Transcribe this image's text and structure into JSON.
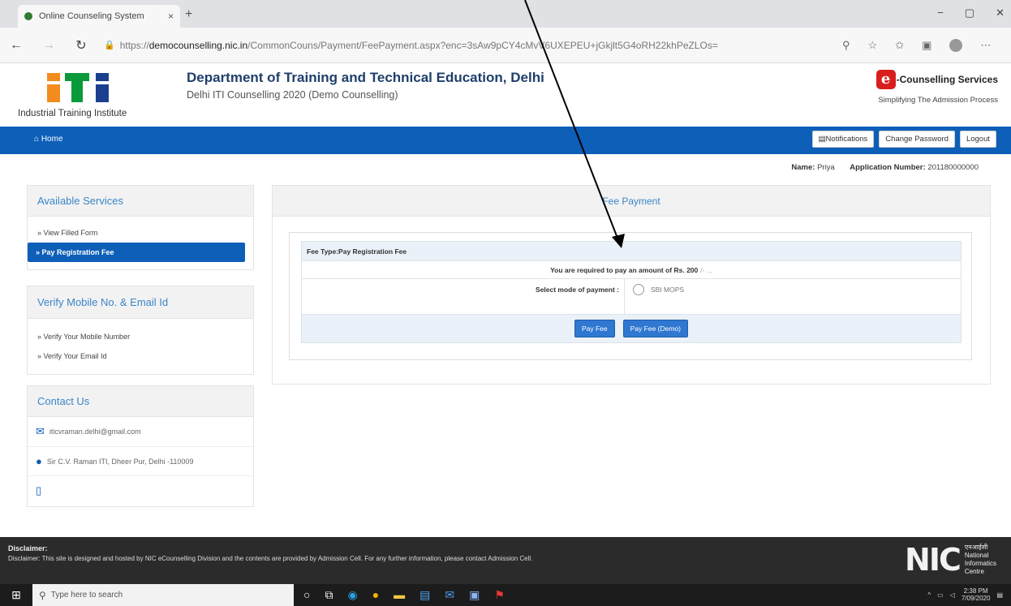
{
  "browser": {
    "tab_title": "Online Counseling System",
    "tab_close": "×",
    "new_tab": "+",
    "url_prefix": "https://",
    "url_host": "democounselling.nic.in",
    "url_path": "/CommonCouns/Payment/FeePayment.aspx?enc=3sAw9pCY4cMvV6UXEPEU+jGkjlt5G4oRH22khPeZLOs=",
    "window_buttons": [
      "−",
      "▢",
      "✕"
    ]
  },
  "header": {
    "iti_caption": "Industrial Training Institute",
    "dept_title": "Department of Training and Technical Education, Delhi",
    "dept_subtitle": "Delhi ITI Counselling 2020 (Demo Counselling)",
    "counselling_title": "-Counselling Services",
    "counselling_tagline": "Simplifying The Admission Process"
  },
  "navbar": {
    "home": "Home",
    "buttons": [
      "Notifications",
      "Change Password",
      "Logout"
    ]
  },
  "user": {
    "name_label": "Name:",
    "name_value": "Priya",
    "app_label": "Application Number:",
    "app_value": "201180000000"
  },
  "sidebar": {
    "services_title": "Available Services",
    "services": [
      "View Filled Form",
      "Pay Registration Fee"
    ],
    "verify_title": "Verify Mobile No. & Email Id",
    "verify_items": [
      "Verify Your Mobile Number",
      "Verify Your Email Id"
    ],
    "contact_title": "Contact Us",
    "contact_email": "iticvraman.delhi@gmail.com",
    "contact_address": "Sir C.V. Raman ITI, Dheer Pur, Delhi -110009"
  },
  "main": {
    "title": "Fee Payment",
    "fee_type": "Fee Type:Pay Registration Fee",
    "required_text": "You are required to pay an amount of Rs. 200",
    "required_extra": "/- ...",
    "mode_label": "Select mode of payment :",
    "mode_option": "SBI MOPS",
    "pay_button": "Pay Fee",
    "pay_demo_button": "Pay Fee (Demo)"
  },
  "footer": {
    "disclaimer_title": "Disclaimer:",
    "disclaimer_text": "Disclaimer: This site is designed and hosted by NIC eCounselling Division and the contents are provided by Admission Cell. For any further information, please contact Admission Cell.",
    "nic_mark": "NIC",
    "nic_line1": "एनआईसी",
    "nic_line2": "National",
    "nic_line3": "Informatics",
    "nic_line4": "Centre"
  },
  "taskbar": {
    "search_placeholder": "Type here to search",
    "time": "2:38 PM",
    "date": "7/09/2020"
  },
  "colors": {
    "brand_blue": "#0d5fb8",
    "link_blue": "#3a86c8",
    "annotation_arrow": "#000000"
  }
}
